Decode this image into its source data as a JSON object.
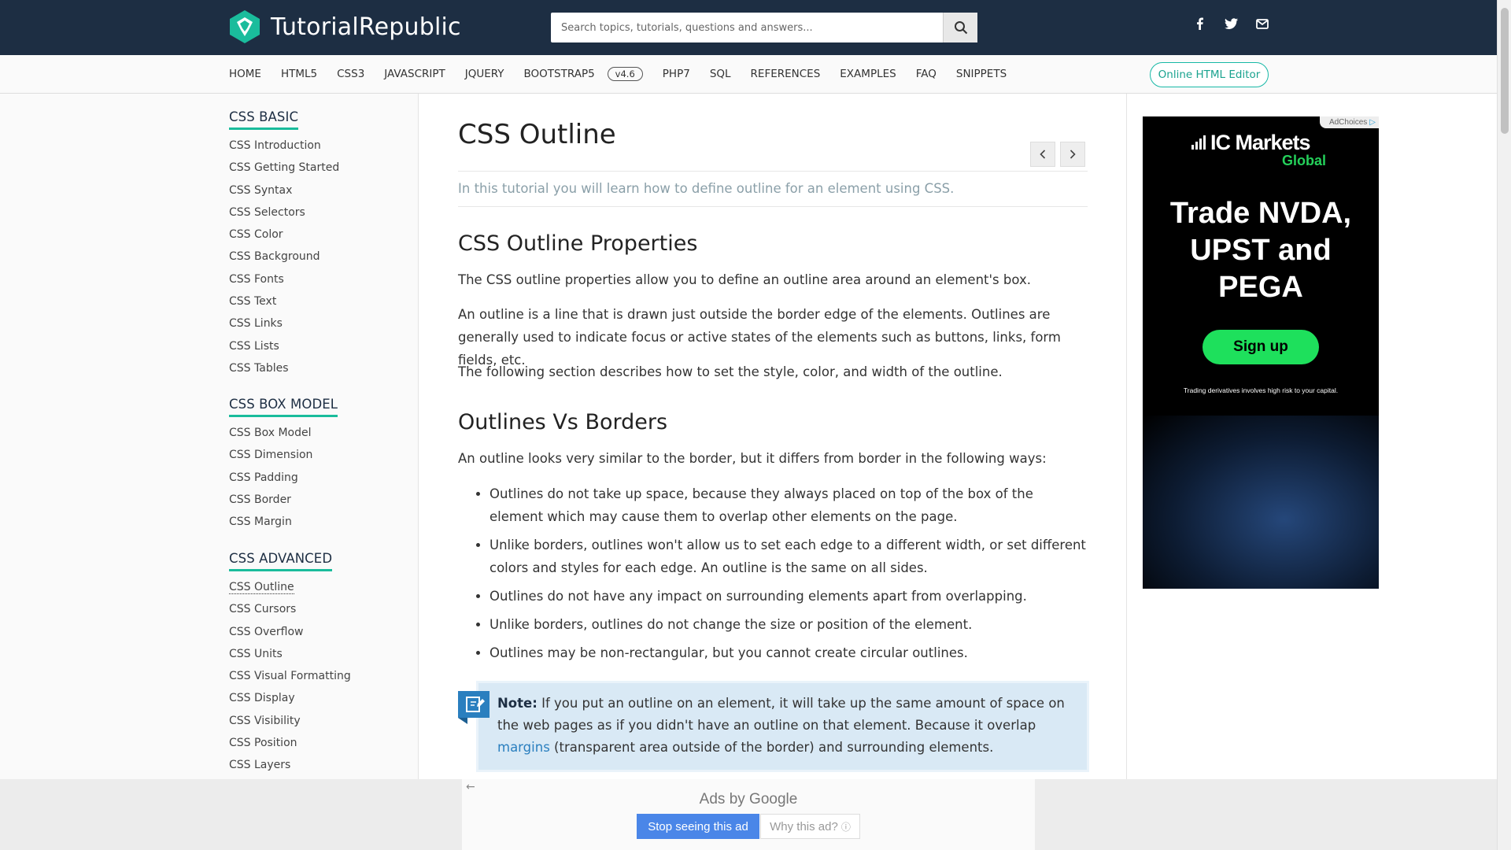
{
  "header": {
    "brand": "TutorialRepublic",
    "search_placeholder": "Search topics, tutorials, questions and answers...",
    "social_icons": [
      "facebook-icon",
      "twitter-icon",
      "mail-icon"
    ]
  },
  "nav": {
    "items": [
      "HOME",
      "HTML5",
      "CSS3",
      "JAVASCRIPT",
      "JQUERY",
      "BOOTSTRAP5",
      "PHP7",
      "SQL",
      "REFERENCES",
      "EXAMPLES",
      "FAQ",
      "SNIPPETS"
    ],
    "bootstrap_badge": "v4.6",
    "editor_button": "Online HTML Editor"
  },
  "sidebar": {
    "sections": [
      {
        "heading": "CSS BASIC",
        "links": [
          "CSS Introduction",
          "CSS Getting Started",
          "CSS Syntax",
          "CSS Selectors",
          "CSS Color",
          "CSS Background",
          "CSS Fonts",
          "CSS Text",
          "CSS Links",
          "CSS Lists",
          "CSS Tables"
        ]
      },
      {
        "heading": "CSS BOX MODEL",
        "links": [
          "CSS Box Model",
          "CSS Dimension",
          "CSS Padding",
          "CSS Border",
          "CSS Margin"
        ]
      },
      {
        "heading": "CSS ADVANCED",
        "links": [
          "CSS Outline",
          "CSS Cursors",
          "CSS Overflow",
          "CSS Units",
          "CSS Visual Formatting",
          "CSS Display",
          "CSS Visibility",
          "CSS Position",
          "CSS Layers"
        ]
      }
    ],
    "active": "CSS Outline"
  },
  "main": {
    "title": "CSS Outline",
    "intro": "In this tutorial you will learn how to define outline for an element using CSS.",
    "h2_properties": "CSS Outline Properties",
    "p1": "The CSS outline properties allow you to define an outline area around an element's box.",
    "p2": "An outline is a line that is drawn just outside the border edge of the elements. Outlines are generally used to indicate focus or active states of the elements such as buttons, links, form fields, etc.",
    "p3": "The following section describes how to set the style, color, and width of the outline.",
    "h2_vs": "Outlines Vs Borders",
    "p4": "An outline looks very similar to the border, but it differs from border in the following ways:",
    "bullets": [
      "Outlines do not take up space, because they always placed on top of the box of the element which may cause them to overlap other elements on the page.",
      "Unlike borders, outlines won't allow us to set each edge to a different width, or set different colors and styles for each edge. An outline is the same on all sides.",
      "Outlines do not have any impact on surrounding elements apart from overlapping.",
      "Unlike borders, outlines do not change the size or position of the element.",
      "Outlines may be non-rectangular, but you cannot create circular outlines."
    ],
    "note_label": "Note:",
    "note_text_1": "If you put an outline on an element, it will take up the same amount of space on the web pages as if you didn't have an outline on that element. Because it overlap",
    "note_link": "margins",
    "note_text_2": "(transparent area outside of the border) and surrounding elements."
  },
  "side_ad": {
    "adchoices": "AdChoices",
    "brand": "IC Markets",
    "brand_sub": "Global",
    "headline_1": "Trade NVDA,",
    "headline_2": "UPST and",
    "headline_3": "PEGA",
    "button": "Sign up",
    "disclaimer": "Trading derivatives involves high risk to your capital."
  },
  "bottom_ad": {
    "ads_by": "Ads by Google",
    "stop": "Stop seeing this ad",
    "why": "Why this ad?"
  },
  "colors": {
    "header_bg": "#1d2e43",
    "accent": "#1abc9c",
    "note_bg": "#d9e9f5",
    "ad_green": "#1ee05c"
  }
}
